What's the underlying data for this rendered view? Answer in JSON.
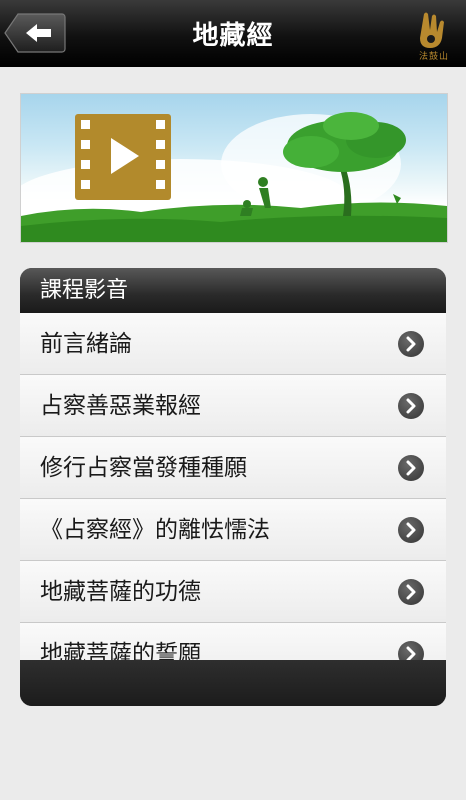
{
  "header": {
    "title": "地藏經",
    "back_icon": "arrow-left-icon",
    "logo_text": "法鼓山",
    "accent": "#b8892e"
  },
  "banner": {
    "icon": "video-play-icon"
  },
  "section": {
    "title": "課程影音"
  },
  "list": {
    "items": [
      {
        "label": "前言緒論"
      },
      {
        "label": "占察善惡業報經"
      },
      {
        "label": "修行占察當發種種願"
      },
      {
        "label": "《占察經》的離怯懦法"
      },
      {
        "label": "地藏菩薩的功德"
      },
      {
        "label": "地藏菩薩的誓願"
      }
    ],
    "chevron_icon": "chevron-right-icon"
  }
}
